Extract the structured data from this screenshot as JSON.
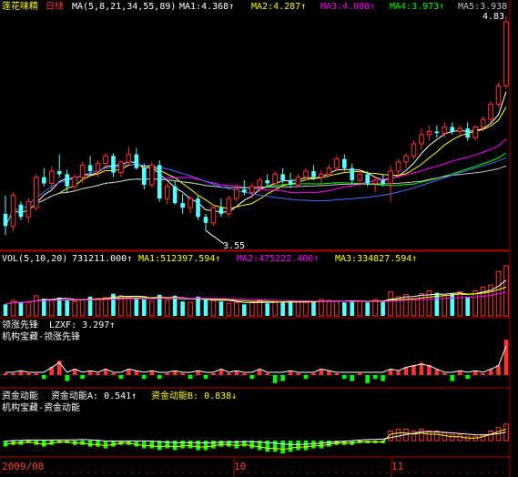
{
  "stock": {
    "name": "莲花味精",
    "period": "日线"
  },
  "main": {
    "ma_label": "MA(5,8,21,34,55,89)",
    "ma": [
      {
        "name": "MA1:",
        "value": "4.368↑",
        "color": "#ffffff"
      },
      {
        "name": "MA2:",
        "value": "4.287↑",
        "color": "#ffff00"
      },
      {
        "name": "MA3:",
        "value": "4.088↑",
        "color": "#ff00ff"
      },
      {
        "name": "MA4:",
        "value": "3.973↑",
        "color": "#00ff00"
      },
      {
        "name": "MA5:",
        "value": "3.938",
        "color": "#c0c0c0"
      }
    ],
    "high_marker": "4.83",
    "low_marker": "3.55"
  },
  "volume": {
    "label": "VOL(5,10,20)",
    "value": "731211.000↑",
    "ma": [
      {
        "name": "MA1:",
        "value": "512397.594↑",
        "color": "#ffff00"
      },
      {
        "name": "MA2:",
        "value": "475222.406↑",
        "color": "#ff00ff"
      },
      {
        "name": "MA3:",
        "value": "334827.594↑",
        "color": "#ffff00"
      }
    ]
  },
  "ind1": {
    "title": "领涨先锋",
    "line_name": "LZXF:",
    "line_value": "3.297↑",
    "subtitle": "机构宝藏-领涨先锋"
  },
  "ind2": {
    "title": "资金动能",
    "a_name": "资金动能A:",
    "a_value": "0.541↑",
    "b_name": "资金动能B:",
    "b_value": "0.838↓",
    "subtitle": "机构宝藏-资金动能"
  },
  "axis": {
    "date_left": "2009/08",
    "mark_10": "10",
    "mark_11": "11"
  },
  "colors": {
    "up": "#ff3232",
    "down": "#54ffff",
    "grid": "#b00000",
    "bg": "#000000"
  },
  "chart_data": {
    "type": "candlestick",
    "ohlc": [
      [
        3.66,
        3.78,
        3.52,
        3.58
      ],
      [
        3.58,
        3.8,
        3.55,
        3.78
      ],
      [
        3.72,
        3.74,
        3.62,
        3.64
      ],
      [
        3.64,
        3.76,
        3.6,
        3.74
      ],
      [
        3.7,
        3.92,
        3.68,
        3.9
      ],
      [
        3.9,
        3.96,
        3.84,
        3.86
      ],
      [
        3.86,
        3.97,
        3.82,
        3.94
      ],
      [
        3.94,
        4.05,
        3.9,
        3.92
      ],
      [
        3.92,
        3.95,
        3.8,
        3.84
      ],
      [
        3.84,
        3.92,
        3.82,
        3.9
      ],
      [
        3.9,
        4.0,
        3.86,
        3.98
      ],
      [
        3.98,
        4.04,
        3.92,
        3.94
      ],
      [
        3.94,
        4.01,
        3.9,
        3.99
      ],
      [
        3.99,
        4.06,
        3.96,
        4.04
      ],
      [
        4.04,
        4.06,
        3.9,
        3.93
      ],
      [
        3.93,
        4.01,
        3.9,
        4.0
      ],
      [
        4.0,
        4.1,
        3.98,
        4.05
      ],
      [
        4.05,
        4.09,
        3.95,
        3.96
      ],
      [
        3.96,
        3.99,
        3.82,
        3.85
      ],
      [
        3.85,
        4.0,
        3.83,
        3.98
      ],
      [
        3.98,
        4.01,
        3.74,
        3.76
      ],
      [
        3.76,
        3.86,
        3.72,
        3.84
      ],
      [
        3.84,
        3.88,
        3.72,
        3.73
      ],
      [
        3.73,
        3.79,
        3.66,
        3.7
      ],
      [
        3.7,
        3.78,
        3.66,
        3.76
      ],
      [
        3.76,
        3.78,
        3.62,
        3.64
      ],
      [
        3.64,
        3.66,
        3.55,
        3.6
      ],
      [
        3.6,
        3.72,
        3.58,
        3.7
      ],
      [
        3.7,
        3.76,
        3.64,
        3.66
      ],
      [
        3.66,
        3.78,
        3.64,
        3.76
      ],
      [
        3.76,
        3.85,
        3.74,
        3.82
      ],
      [
        3.82,
        3.88,
        3.78,
        3.8
      ],
      [
        3.8,
        3.86,
        3.76,
        3.84
      ],
      [
        3.84,
        3.9,
        3.8,
        3.88
      ],
      [
        3.88,
        3.92,
        3.84,
        3.86
      ],
      [
        3.86,
        3.94,
        3.84,
        3.92
      ],
      [
        3.92,
        3.96,
        3.86,
        3.88
      ],
      [
        3.88,
        3.93,
        3.83,
        3.85
      ],
      [
        3.85,
        3.92,
        3.84,
        3.9
      ],
      [
        3.9,
        3.96,
        3.88,
        3.94
      ],
      [
        3.94,
        3.98,
        3.88,
        3.9
      ],
      [
        3.9,
        3.95,
        3.86,
        3.92
      ],
      [
        3.92,
        3.98,
        3.9,
        3.96
      ],
      [
        3.96,
        4.04,
        3.94,
        4.02
      ],
      [
        4.02,
        4.05,
        3.94,
        3.96
      ],
      [
        3.96,
        3.99,
        3.86,
        3.88
      ],
      [
        3.88,
        3.94,
        3.84,
        3.92
      ],
      [
        3.92,
        3.94,
        3.84,
        3.86
      ],
      [
        3.86,
        3.9,
        3.8,
        3.88
      ],
      [
        3.88,
        3.92,
        3.84,
        3.86
      ],
      [
        3.86,
        3.98,
        3.74,
        3.94
      ],
      [
        3.94,
        4.02,
        3.9,
        4.0
      ],
      [
        4.0,
        4.06,
        3.96,
        4.04
      ],
      [
        4.04,
        4.14,
        4.02,
        4.12
      ],
      [
        4.12,
        4.22,
        4.08,
        4.18
      ],
      [
        4.18,
        4.24,
        4.14,
        4.2
      ],
      [
        4.2,
        4.24,
        4.16,
        4.19
      ],
      [
        4.19,
        4.26,
        4.16,
        4.23
      ],
      [
        4.23,
        4.26,
        4.18,
        4.2
      ],
      [
        4.2,
        4.24,
        4.16,
        4.22
      ],
      [
        4.22,
        4.26,
        4.14,
        4.16
      ],
      [
        4.16,
        4.24,
        4.14,
        4.23
      ],
      [
        4.23,
        4.3,
        4.2,
        4.28
      ],
      [
        4.28,
        4.4,
        4.26,
        4.38
      ],
      [
        4.38,
        4.52,
        4.36,
        4.5
      ],
      [
        4.5,
        4.96,
        4.48,
        4.92
      ]
    ],
    "volume": [
      120,
      160,
      140,
      150,
      210,
      180,
      170,
      190,
      160,
      150,
      170,
      200,
      180,
      190,
      230,
      210,
      200,
      190,
      170,
      150,
      220,
      160,
      210,
      150,
      140,
      200,
      170,
      160,
      150,
      130,
      140,
      120,
      150,
      160,
      130,
      150,
      140,
      160,
      150,
      140,
      150,
      170,
      160,
      150,
      140,
      160,
      150,
      140,
      170,
      150,
      250,
      200,
      220,
      180,
      230,
      260,
      240,
      210,
      230,
      250,
      200,
      260,
      300,
      320,
      460,
      520
    ],
    "lzxf": [
      0,
      0,
      1,
      0,
      0,
      -1,
      3,
      6,
      -2,
      2,
      -1,
      1,
      0,
      2,
      0,
      -1,
      2,
      1,
      -1,
      1,
      -1,
      0,
      1,
      0,
      -1,
      1,
      -1,
      0,
      2,
      0,
      1,
      0,
      -1,
      2,
      0,
      -3,
      -2,
      1,
      0,
      -1,
      0,
      2,
      1,
      0,
      -1,
      -2,
      0,
      -3,
      -1,
      -2,
      2,
      1,
      3,
      4,
      5,
      4,
      2,
      0,
      -2,
      1,
      -1,
      1,
      0,
      2,
      4,
      16
    ],
    "zjdn": [
      -3,
      -2,
      -2,
      -1,
      -2,
      -3,
      -2,
      -1,
      -1,
      -2,
      -2,
      -3,
      -3,
      -4,
      -3,
      -2,
      -2,
      -3,
      -4,
      -4,
      -5,
      -4,
      -5,
      -4,
      -4,
      -5,
      -5,
      -4,
      -3,
      -3,
      -4,
      -3,
      -4,
      -5,
      -6,
      -6,
      -7,
      -6,
      -5,
      -5,
      -4,
      -4,
      -3,
      -2,
      -2,
      -2,
      -1,
      -1,
      -1,
      -1,
      5,
      6,
      6,
      5,
      6,
      5,
      5,
      4,
      3,
      3,
      2,
      2,
      3,
      5,
      7,
      9
    ]
  }
}
